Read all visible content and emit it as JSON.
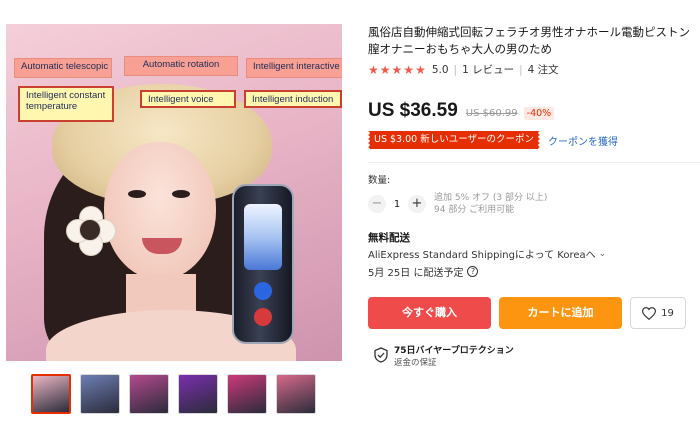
{
  "image": {
    "annotations": [
      {
        "text": "Automatic telescopic",
        "style": "pink"
      },
      {
        "text": "Automatic rotation",
        "style": "pink"
      },
      {
        "text": "Intelligent interactive",
        "style": "pink"
      },
      {
        "text": "Intelligent constant temperature",
        "style": "yellow"
      },
      {
        "text": "Intelligent voice",
        "style": "yellow"
      },
      {
        "text": "Intelligent induction",
        "style": "yellow"
      }
    ],
    "thumbnail_colors": [
      "#e9b6c3",
      "#6d7fb4",
      "#b44a8e",
      "#7a2fae",
      "#cc3a7a",
      "#d76a8a"
    ]
  },
  "product": {
    "title": "風俗店自動伸縮式回転フェラチオ男性オナホール電動ピストン膣オナニーおもちゃ大人の男のため",
    "rating": "5.0",
    "reviews": "1 レビュー",
    "orders": "4 注文",
    "price": "US $36.59",
    "original_price": "US $60.99",
    "discount": "-40%"
  },
  "coupon": {
    "label": "US $3.00 新しいユーザーのクーポン",
    "link": "クーポンを獲得"
  },
  "quantity": {
    "label": "数量:",
    "value": "1",
    "minus": "−",
    "plus": "+",
    "note_line1": "追加 5% オフ (3 部分 以上)",
    "note_line2": "94 部分 ご利用可能"
  },
  "shipping": {
    "title": "無料配送",
    "method": "AliExpress Standard Shippingによって Koreaへ",
    "chevron": "⌄",
    "delivery": "5月 25日 に配送予定",
    "help": "?"
  },
  "actions": {
    "buy_now": "今すぐ購入",
    "add_to_cart": "カートに追加",
    "wishlist_count": "19"
  },
  "protection": {
    "title": "75日バイヤープロテクション",
    "subtitle": "返金の保証"
  },
  "colors": {
    "accent_red": "#e62e04",
    "buy_button": "#f04b4b",
    "cart_button": "#fd9510",
    "link_blue": "#2a6ac9",
    "star": "#f25a4b"
  }
}
